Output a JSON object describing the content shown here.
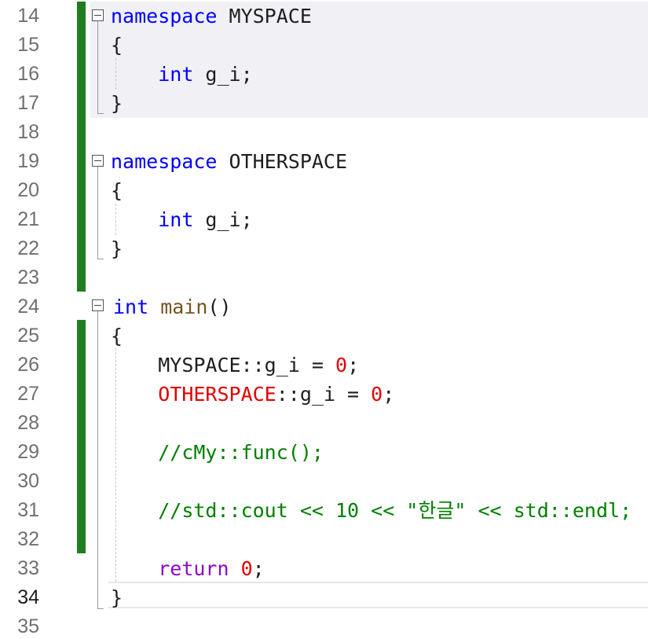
{
  "editor": {
    "line_numbers": [
      "14",
      "15",
      "16",
      "17",
      "18",
      "19",
      "20",
      "21",
      "22",
      "23",
      "24",
      "25",
      "26",
      "27",
      "28",
      "29",
      "30",
      "31",
      "32",
      "33",
      "34",
      "35"
    ],
    "current_line": "34",
    "code": {
      "l14": {
        "kw": "namespace",
        "name": " MYSPACE"
      },
      "l15": {
        "text": "{"
      },
      "l16": {
        "indent": "    ",
        "kw": "int",
        "rest": " g_i;"
      },
      "l17": {
        "text": "}"
      },
      "l19": {
        "kw": "namespace",
        "name": " OTHERSPACE"
      },
      "l20": {
        "text": "{"
      },
      "l21": {
        "indent": "    ",
        "kw": "int",
        "rest": " g_i;"
      },
      "l22": {
        "text": "}"
      },
      "l24": {
        "kw": "int",
        "fn": " main",
        "rest": "()"
      },
      "l25": {
        "text": "{"
      },
      "l26": {
        "indent": "    ",
        "a": "MYSPACE::g_i = ",
        "num": "0",
        "b": ";"
      },
      "l27": {
        "indent": "    ",
        "err": "OTHERSPACE",
        "a": "::g_i = ",
        "num": "0",
        "b": ";"
      },
      "l29": {
        "indent": "    ",
        "comment": "//cMy::func();"
      },
      "l31": {
        "indent": "    ",
        "comment": "//std::cout << 10 << \"한글\" << std::endl;"
      },
      "l33": {
        "indent": "    ",
        "kw": "return",
        "sp": " ",
        "num": "0",
        "b": ";"
      },
      "l34": {
        "text": "}"
      }
    },
    "colors": {
      "keyword": "#0000ff",
      "control_keyword": "#8f08c4",
      "function": "#74531f",
      "number": "#e00000",
      "error_squiggle_text": "#e00000",
      "comment": "#008000",
      "change_bar": "#1f7d1f",
      "line_number": "#6f6f6f"
    }
  }
}
